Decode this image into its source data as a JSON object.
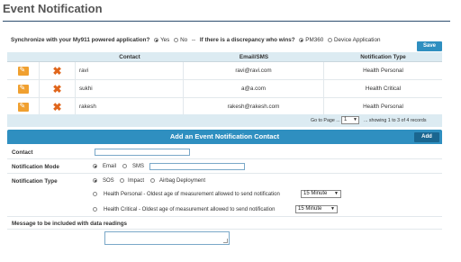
{
  "page": {
    "title": "Event Notification"
  },
  "sync": {
    "question": "Synchronize with your My911 powered application?",
    "yes": "Yes",
    "no": "No",
    "separator": "--",
    "discrepancy_question": "If there is a discrepancy who wins?",
    "pm360": "PM360",
    "device_application": "Device Application",
    "save_label": "Save",
    "sync_selected": "Yes",
    "winner_selected": "PM360"
  },
  "grid": {
    "columns": [
      "",
      "",
      "Contact",
      "Email/SMS",
      "Notification Type"
    ],
    "rows": [
      {
        "contact": "ravi",
        "email": "ravi@ravi.com",
        "notification_type": "Health Personal"
      },
      {
        "contact": "sukhi",
        "email": "a@a.com",
        "notification_type": "Health Critical"
      },
      {
        "contact": "rakesh",
        "email": "rakesh@rakesh.com",
        "notification_type": "Health Personal"
      }
    ],
    "pager": {
      "goto_label": "Go to Page ...",
      "page_value": "1",
      "info": "... showing 1 to 3 of 4 records"
    }
  },
  "form": {
    "header": "Add an Event Notification Contact",
    "add_label": "Add",
    "contact_label": "Contact",
    "mode_label": "Notification Mode",
    "mode_email": "Email",
    "mode_sms": "SMS",
    "mode_selected": "Email",
    "type_label": "Notification Type",
    "type_sos": "SOS",
    "type_impact": "Impact",
    "type_airbag": "Airbag Deployment",
    "type_selected": "SOS",
    "health_personal": "Health Personal - Oldest age of measurement allowed to send notification",
    "health_personal_value": "15 Minute",
    "health_critical": "Health Critical - Oldest age of measurement allowed to send notification",
    "health_critical_value": "15 Minute",
    "message_label": "Message to be included with data readings"
  },
  "colors": {
    "accent": "#2f8fc0",
    "title_rule": "#2d4d6e",
    "edit_icon": "#f0a030",
    "delete_icon": "#e0661c",
    "grid_header": "#dcebf2"
  }
}
